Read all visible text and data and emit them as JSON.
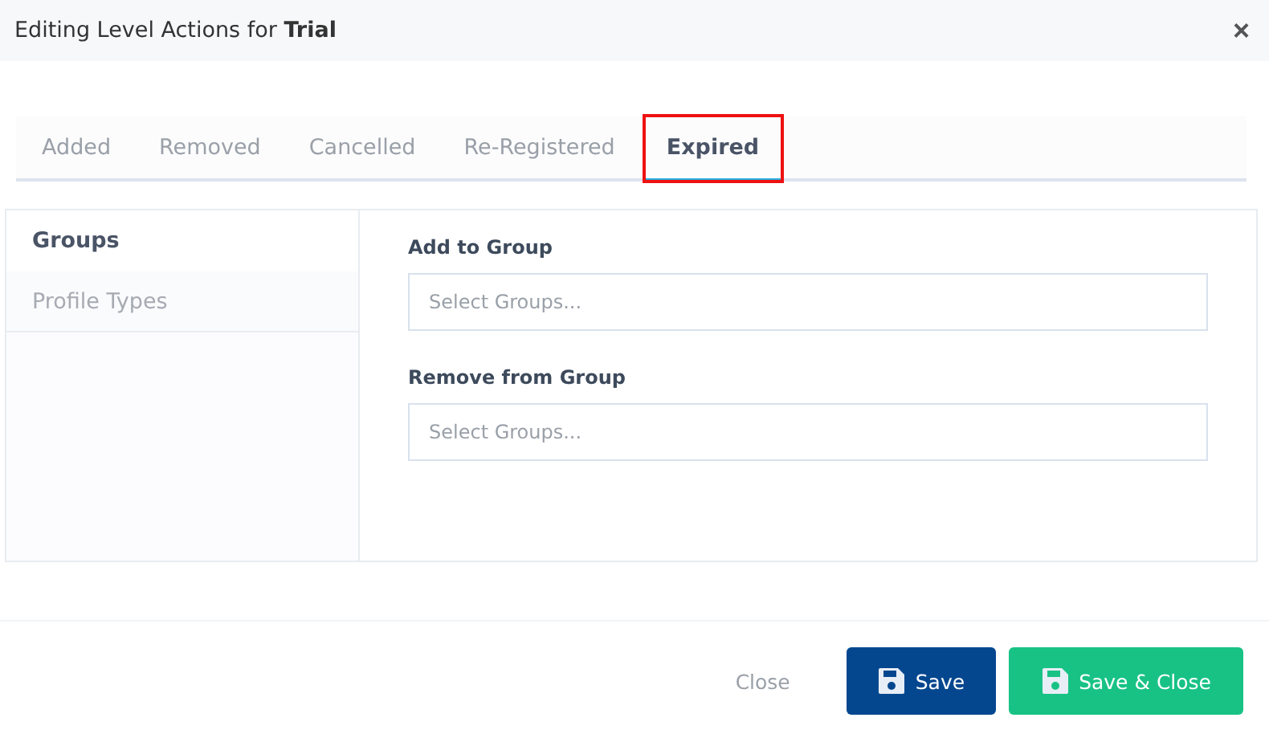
{
  "window": {
    "title": "Editing Level Actions for **Trial**",
    "close": "×"
  },
  "tabs": [
    {
      "label": "Added",
      "selected": false,
      "highlighted": false
    },
    {
      "label": "Removed",
      "selected": false,
      "highlighted": false
    },
    {
      "label": "Cancelled",
      "selected": false,
      "highlighted": false
    },
    {
      "label": "Re-Registered",
      "selected": false,
      "highlighted": false
    },
    {
      "label": "Expired",
      "selected": true,
      "highlighted": true
    }
  ],
  "sidebar": {
    "items": [
      {
        "label": "Groups",
        "selected": true
      },
      {
        "label": "Profile Types",
        "selected": false
      }
    ]
  },
  "fields": [
    {
      "label": "Add to Group",
      "placeholder": "Select Groups..."
    },
    {
      "label": "Remove from Group",
      "placeholder": "Select Groups..."
    }
  ],
  "buttons": [
    {
      "label": "Close",
      "kind": "link"
    },
    {
      "label": "Save",
      "kind": "primary"
    },
    {
      "label": "Save & Close",
      "kind": "success"
    }
  ]
}
